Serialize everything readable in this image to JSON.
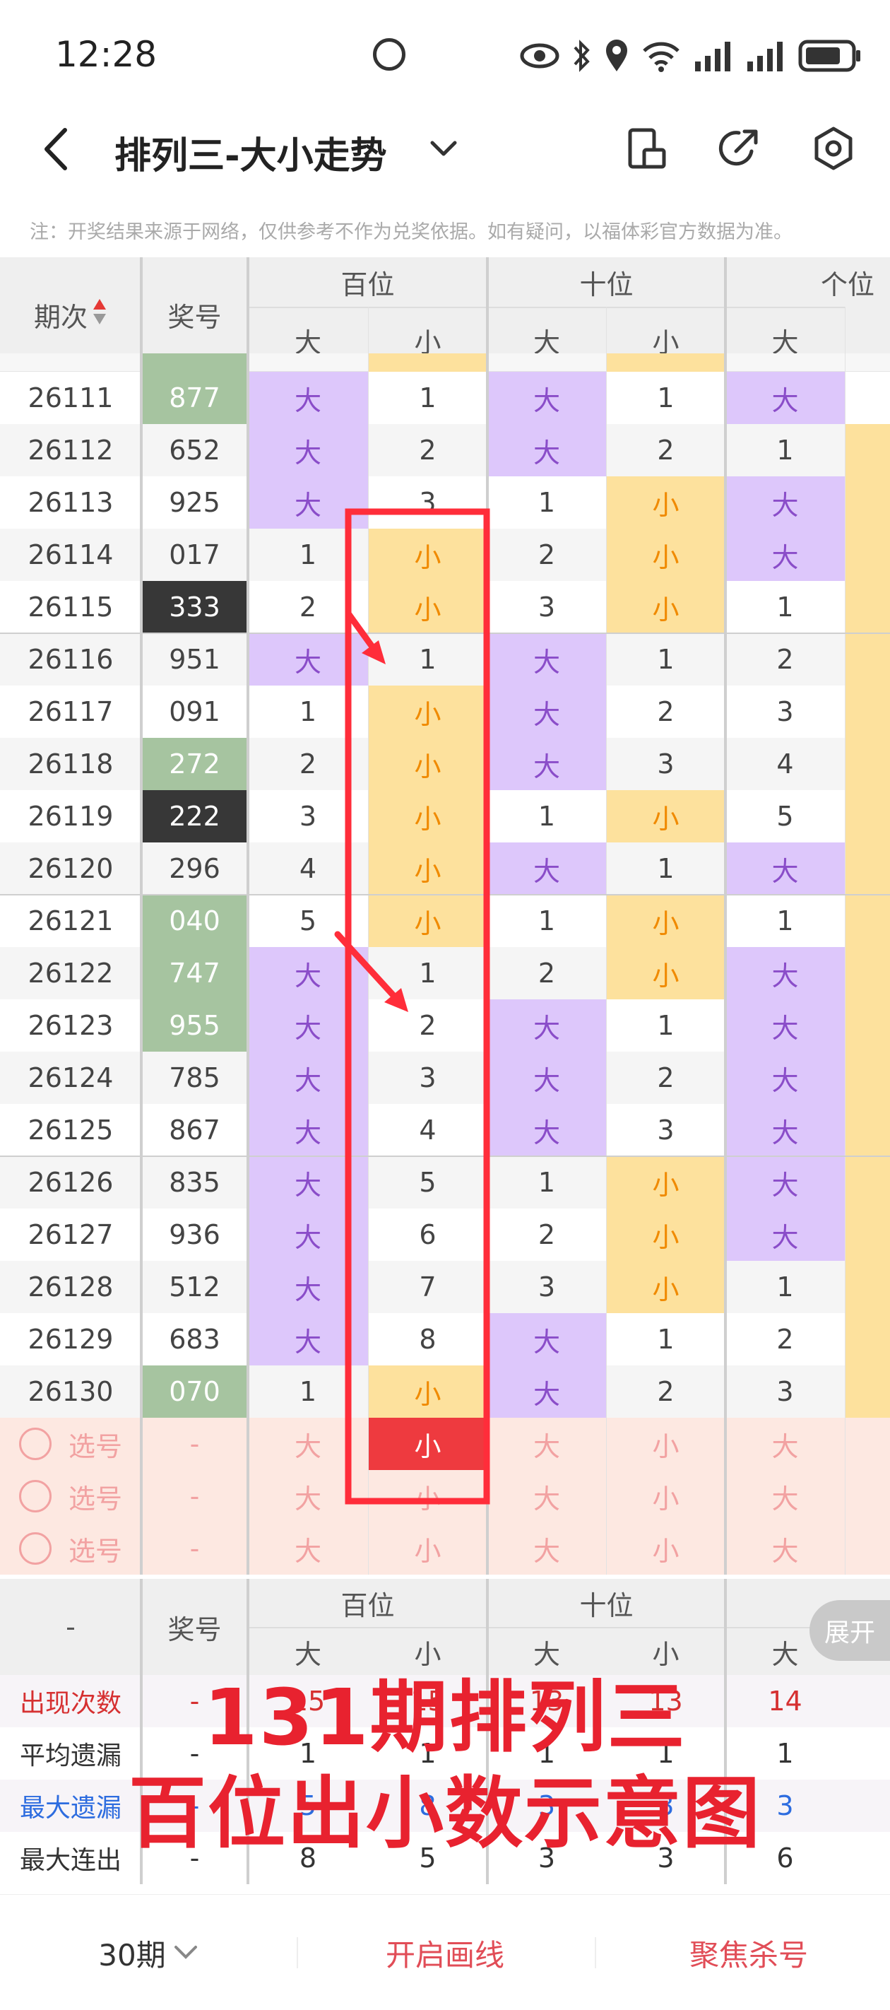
{
  "status_bar": {
    "time": "12:28"
  },
  "header": {
    "title": "排列三-大小走势"
  },
  "notice": "注：开奖结果来源于网络，仅供参考不作为兑奖依据。如有疑问，以福体彩官方数据为准。",
  "table_header": {
    "col_period": "期次",
    "col_number": "奖号",
    "hundreds": "百位",
    "tens": "十位",
    "units": "个位",
    "big": "大",
    "small": "小"
  },
  "rows": [
    {
      "period": "26111",
      "number": "877",
      "style": "green",
      "cells": [
        "大",
        "1",
        "大",
        "1",
        "大"
      ]
    },
    {
      "period": "26112",
      "number": "652",
      "style": "",
      "cells": [
        "大",
        "2",
        "大",
        "2",
        "1"
      ]
    },
    {
      "period": "26113",
      "number": "925",
      "style": "",
      "cells": [
        "大",
        "3",
        "1",
        "小",
        "大"
      ]
    },
    {
      "period": "26114",
      "number": "017",
      "style": "",
      "cells": [
        "1",
        "小",
        "2",
        "小",
        "大"
      ]
    },
    {
      "period": "26115",
      "number": "333",
      "style": "dark",
      "cells": [
        "2",
        "小",
        "3",
        "小",
        "1"
      ]
    },
    {
      "period": "26116",
      "number": "951",
      "style": "",
      "cells": [
        "大",
        "1",
        "大",
        "1",
        "2"
      ]
    },
    {
      "period": "26117",
      "number": "091",
      "style": "",
      "cells": [
        "1",
        "小",
        "大",
        "2",
        "3"
      ]
    },
    {
      "period": "26118",
      "number": "272",
      "style": "green",
      "cells": [
        "2",
        "小",
        "大",
        "3",
        "4"
      ]
    },
    {
      "period": "26119",
      "number": "222",
      "style": "dark",
      "cells": [
        "3",
        "小",
        "1",
        "小",
        "5"
      ]
    },
    {
      "period": "26120",
      "number": "296",
      "style": "",
      "cells": [
        "4",
        "小",
        "大",
        "1",
        "大"
      ]
    },
    {
      "period": "26121",
      "number": "040",
      "style": "green",
      "cells": [
        "5",
        "小",
        "1",
        "小",
        "1"
      ]
    },
    {
      "period": "26122",
      "number": "747",
      "style": "green",
      "cells": [
        "大",
        "1",
        "2",
        "小",
        "大"
      ]
    },
    {
      "period": "26123",
      "number": "955",
      "style": "green",
      "cells": [
        "大",
        "2",
        "大",
        "1",
        "大"
      ]
    },
    {
      "period": "26124",
      "number": "785",
      "style": "",
      "cells": [
        "大",
        "3",
        "大",
        "2",
        "大"
      ]
    },
    {
      "period": "26125",
      "number": "867",
      "style": "",
      "cells": [
        "大",
        "4",
        "大",
        "3",
        "大"
      ]
    },
    {
      "period": "26126",
      "number": "835",
      "style": "",
      "cells": [
        "大",
        "5",
        "1",
        "小",
        "大"
      ]
    },
    {
      "period": "26127",
      "number": "936",
      "style": "",
      "cells": [
        "大",
        "6",
        "2",
        "小",
        "大"
      ]
    },
    {
      "period": "26128",
      "number": "512",
      "style": "",
      "cells": [
        "大",
        "7",
        "3",
        "小",
        "1"
      ]
    },
    {
      "period": "26129",
      "number": "683",
      "style": "",
      "cells": [
        "大",
        "8",
        "大",
        "1",
        "2"
      ]
    },
    {
      "period": "26130",
      "number": "070",
      "style": "green",
      "cells": [
        "1",
        "小",
        "大",
        "2",
        "3"
      ]
    }
  ],
  "pick_rows": {
    "label": "选号",
    "dash": "-",
    "cells": [
      "大",
      "小",
      "大",
      "小",
      "大"
    ]
  },
  "footer_header": {
    "dash": "-",
    "number": "奖号",
    "hundreds": "百位",
    "tens": "十位",
    "big": "大",
    "small": "小",
    "expand": "展开"
  },
  "stats": [
    {
      "label": "出现次数",
      "color": "#d63031",
      "dash": "-",
      "values": [
        "15",
        "15",
        "13",
        "13",
        "14"
      ]
    },
    {
      "label": "平均遗漏",
      "color": "#333333",
      "dash": "-",
      "values": [
        "1",
        "1",
        "1",
        "1",
        "1"
      ]
    },
    {
      "label": "最大遗漏",
      "color": "#2d6cdf",
      "dash": "-",
      "values": [
        "5",
        "8",
        "3",
        "3",
        "3"
      ]
    },
    {
      "label": "最大连出",
      "color": "#333333",
      "dash": "-",
      "values": [
        "8",
        "5",
        "3",
        "3",
        "6"
      ]
    }
  ],
  "overlay": {
    "line1": "131期排列三",
    "line2": "百位出小数示意图"
  },
  "bottom_bar": {
    "period_select": "30期",
    "draw_line": "开启画线",
    "focus_kill": "聚焦杀号"
  }
}
